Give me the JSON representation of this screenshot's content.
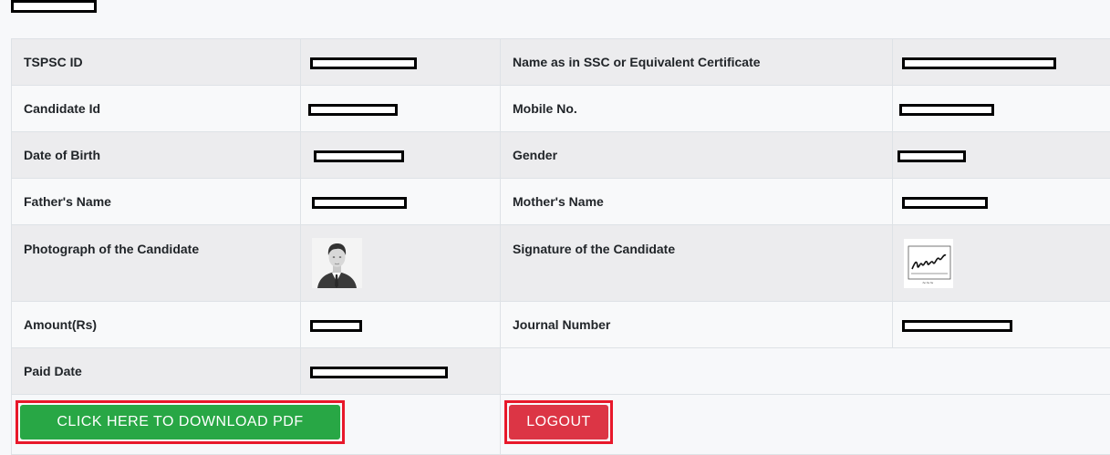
{
  "rows": [
    {
      "l1": "TSPSC ID",
      "l2": "Name as in SSC or Equivalent Certificate"
    },
    {
      "l1": "Candidate Id",
      "l2": "Mobile No."
    },
    {
      "l1": "Date of Birth",
      "l2": "Gender"
    },
    {
      "l1": "Father's Name",
      "l2": "Mother's Name"
    },
    {
      "l1": "Photograph of the Candidate",
      "l2": "Signature of the Candidate"
    },
    {
      "l1": "Amount(Rs)",
      "l2": "Journal Number"
    },
    {
      "l1": "Paid Date"
    }
  ],
  "buttons": {
    "download": "CLICK HERE TO DOWNLOAD PDF",
    "logout": "LOGOUT"
  },
  "images": {
    "photo": "candidate-photo-icon",
    "signature": "signature-icon"
  },
  "colors": {
    "download_button": "#28a745",
    "logout_button": "#dc3545",
    "highlight_border": "#e8182a",
    "redaction": "#000000"
  }
}
